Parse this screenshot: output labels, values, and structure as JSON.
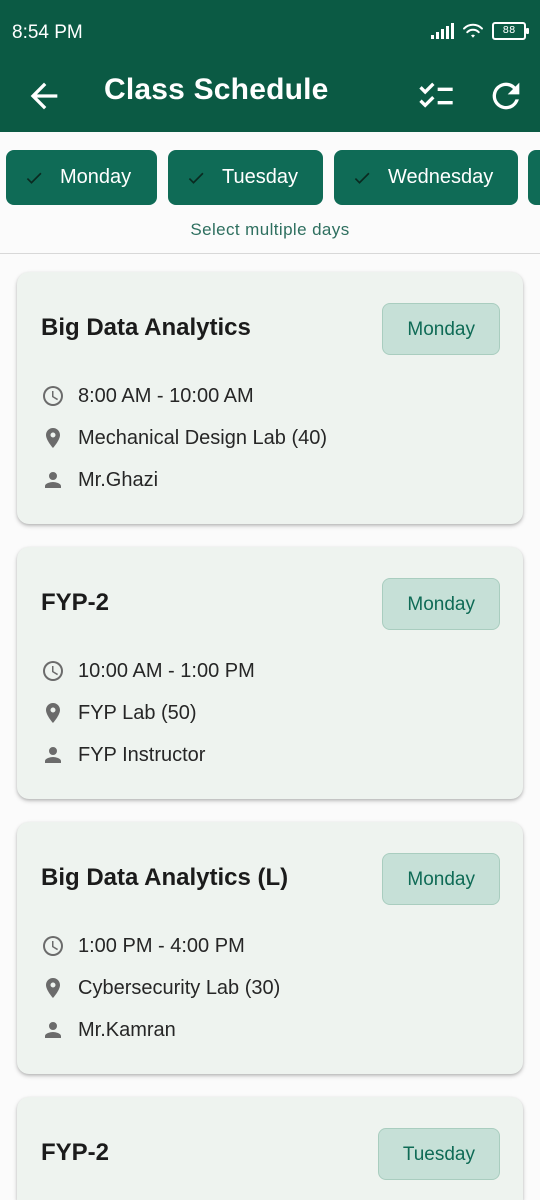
{
  "status_bar": {
    "time": "8:54 PM",
    "battery": "88"
  },
  "app_bar": {
    "title": "Class Schedule"
  },
  "filters": {
    "chips": [
      {
        "label": "Monday"
      },
      {
        "label": "Tuesday"
      },
      {
        "label": "Wednesday"
      }
    ],
    "hint": "Select multiple days"
  },
  "classes": [
    {
      "title": "Big Data Analytics",
      "day": "Monday",
      "time": "8:00 AM - 10:00 AM",
      "room": "Mechanical Design Lab (40)",
      "instructor": "Mr.Ghazi"
    },
    {
      "title": "FYP-2",
      "day": "Monday",
      "time": "10:00 AM - 1:00 PM",
      "room": "FYP Lab (50)",
      "instructor": "FYP Instructor"
    },
    {
      "title": "Big Data Analytics (L)",
      "day": "Monday",
      "time": "1:00 PM - 4:00 PM",
      "room": "Cybersecurity Lab (30)",
      "instructor": "Mr.Kamran"
    },
    {
      "title": "FYP-2",
      "day": "Tuesday"
    }
  ],
  "colors": {
    "primary": "#0b5a44",
    "chip": "#0f6b56",
    "card_bg": "#eef3ef",
    "badge_bg": "#c6e0d7",
    "icon_grey": "#6b6b6b"
  },
  "icons": {
    "back": "arrow-back-icon",
    "checklist": "checklist-icon",
    "refresh": "refresh-icon",
    "chip_check": "check-icon",
    "time": "clock-icon",
    "room": "location-pin-icon",
    "instructor": "person-icon"
  }
}
